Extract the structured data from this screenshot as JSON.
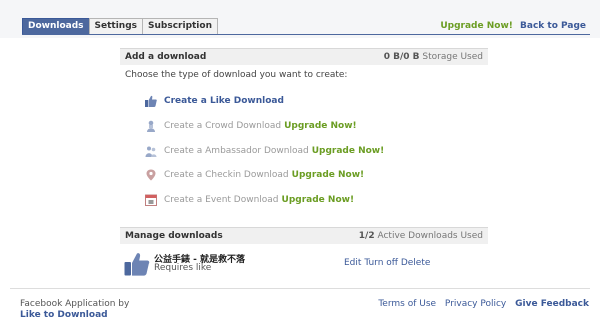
{
  "tabs": [
    {
      "label": "Downloads",
      "active": true
    },
    {
      "label": "Settings",
      "active": false
    },
    {
      "label": "Subscription",
      "active": false
    }
  ],
  "header": {
    "upgrade": "Upgrade Now!",
    "back": "Back to Page"
  },
  "add_panel": {
    "title": "Add a download",
    "storage_value": "0 B/0 B",
    "storage_label": "Storage Used",
    "prompt": "Choose the type of download you want to create:",
    "options": [
      {
        "label": "Create a Like Download",
        "upgrade": "",
        "icon": "thumbs-up-icon",
        "enabled": true
      },
      {
        "label": "Create a Crowd Download",
        "upgrade": "Upgrade Now!",
        "icon": "crowd-icon",
        "enabled": false
      },
      {
        "label": "Create a Ambassador Download",
        "upgrade": "Upgrade Now!",
        "icon": "ambassador-icon",
        "enabled": false
      },
      {
        "label": "Create a Checkin Download",
        "upgrade": "Upgrade Now!",
        "icon": "map-pin-icon",
        "enabled": false
      },
      {
        "label": "Create a Event Download",
        "upgrade": "Upgrade Now!",
        "icon": "calendar-icon",
        "enabled": false
      }
    ]
  },
  "manage_panel": {
    "title": "Manage downloads",
    "active_value": "1/2",
    "active_label": "Active Downloads Used",
    "rows": [
      {
        "name": "公益手錶 - 就是救不落",
        "sub": "Requires like",
        "actions": [
          "Edit",
          "Turn off",
          "Delete"
        ]
      }
    ]
  },
  "footer": {
    "line1": "Facebook Application by",
    "app_name": "Like to Download",
    "links": [
      "Terms of Use",
      "Privacy Policy",
      "Give Feedback"
    ]
  },
  "colors": {
    "accent": "#3b5998",
    "tab_active": "#4d689e",
    "upgrade_green": "#6b9d23"
  }
}
